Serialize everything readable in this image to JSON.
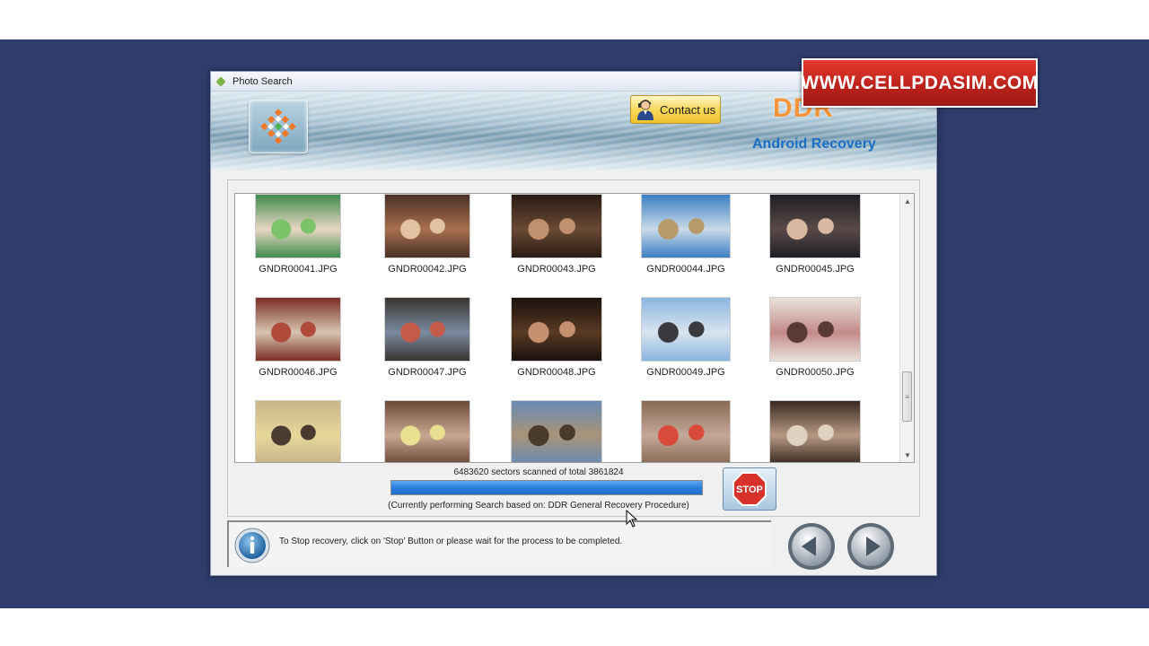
{
  "window": {
    "title": "Photo Search"
  },
  "banner": {
    "contact_label": "Contact us",
    "brand_name": "DDR",
    "brand_subtitle": "Android Recovery"
  },
  "photos": [
    {
      "name": "GNDR00041.JPG",
      "colors": [
        "#3f8a4a",
        "#e8d7c4",
        "#7cc36a"
      ]
    },
    {
      "name": "GNDR00042.JPG",
      "colors": [
        "#4a3024",
        "#a87050",
        "#e2c2a0"
      ]
    },
    {
      "name": "GNDR00043.JPG",
      "colors": [
        "#2a1a14",
        "#6a4a34",
        "#c09070"
      ]
    },
    {
      "name": "GNDR00044.JPG",
      "colors": [
        "#3a7ec2",
        "#c9dbe8",
        "#b89a6a"
      ]
    },
    {
      "name": "GNDR00045.JPG",
      "colors": [
        "#1e1e24",
        "#5a4a48",
        "#d8b8a4"
      ]
    },
    {
      "name": "GNDR00046.JPG",
      "colors": [
        "#7a2f24",
        "#d8c4b0",
        "#b04a3a"
      ]
    },
    {
      "name": "GNDR00047.JPG",
      "colors": [
        "#3a3430",
        "#7a8aa0",
        "#c45a48"
      ]
    },
    {
      "name": "GNDR00048.JPG",
      "colors": [
        "#1a120e",
        "#5a3a24",
        "#c49070"
      ]
    },
    {
      "name": "GNDR00049.JPG",
      "colors": [
        "#8ab6e0",
        "#d8e4ee",
        "#3a3a3e"
      ]
    },
    {
      "name": "GNDR00050.JPG",
      "colors": [
        "#e8e2da",
        "#c48a8a",
        "#5a3a34"
      ]
    },
    {
      "name": "",
      "colors": [
        "#c8b48a",
        "#e6d89a",
        "#4a3a30"
      ]
    },
    {
      "name": "",
      "colors": [
        "#6a4a38",
        "#c8a890",
        "#e8e090"
      ]
    },
    {
      "name": "",
      "colors": [
        "#6a8ab4",
        "#a89478",
        "#4a3a2a"
      ]
    },
    {
      "name": "",
      "colors": [
        "#8a6a54",
        "#c4a898",
        "#d84a3a"
      ]
    },
    {
      "name": "",
      "colors": [
        "#3a2a22",
        "#b89a84",
        "#e0d0c0"
      ]
    }
  ],
  "scan": {
    "scanned": "6483620",
    "sectors_text": "sectors scanned of total",
    "total": "3861824",
    "progress": 1.0,
    "status": "(Currently performing Search based on:  DDR General Recovery Procedure)",
    "stop_label": "STOP"
  },
  "info": {
    "message": "To Stop recovery, click on 'Stop' Button or please wait for the process to be completed."
  },
  "watermark": {
    "text": "WWW.CELLPDASIM.COM"
  },
  "colors": {
    "desktop": "#2e3d6b",
    "progress": "#2a7fdc",
    "brand_orange": "#ff8a1e",
    "brand_blue": "#1a6fc4",
    "stop_red": "#d8322a"
  }
}
